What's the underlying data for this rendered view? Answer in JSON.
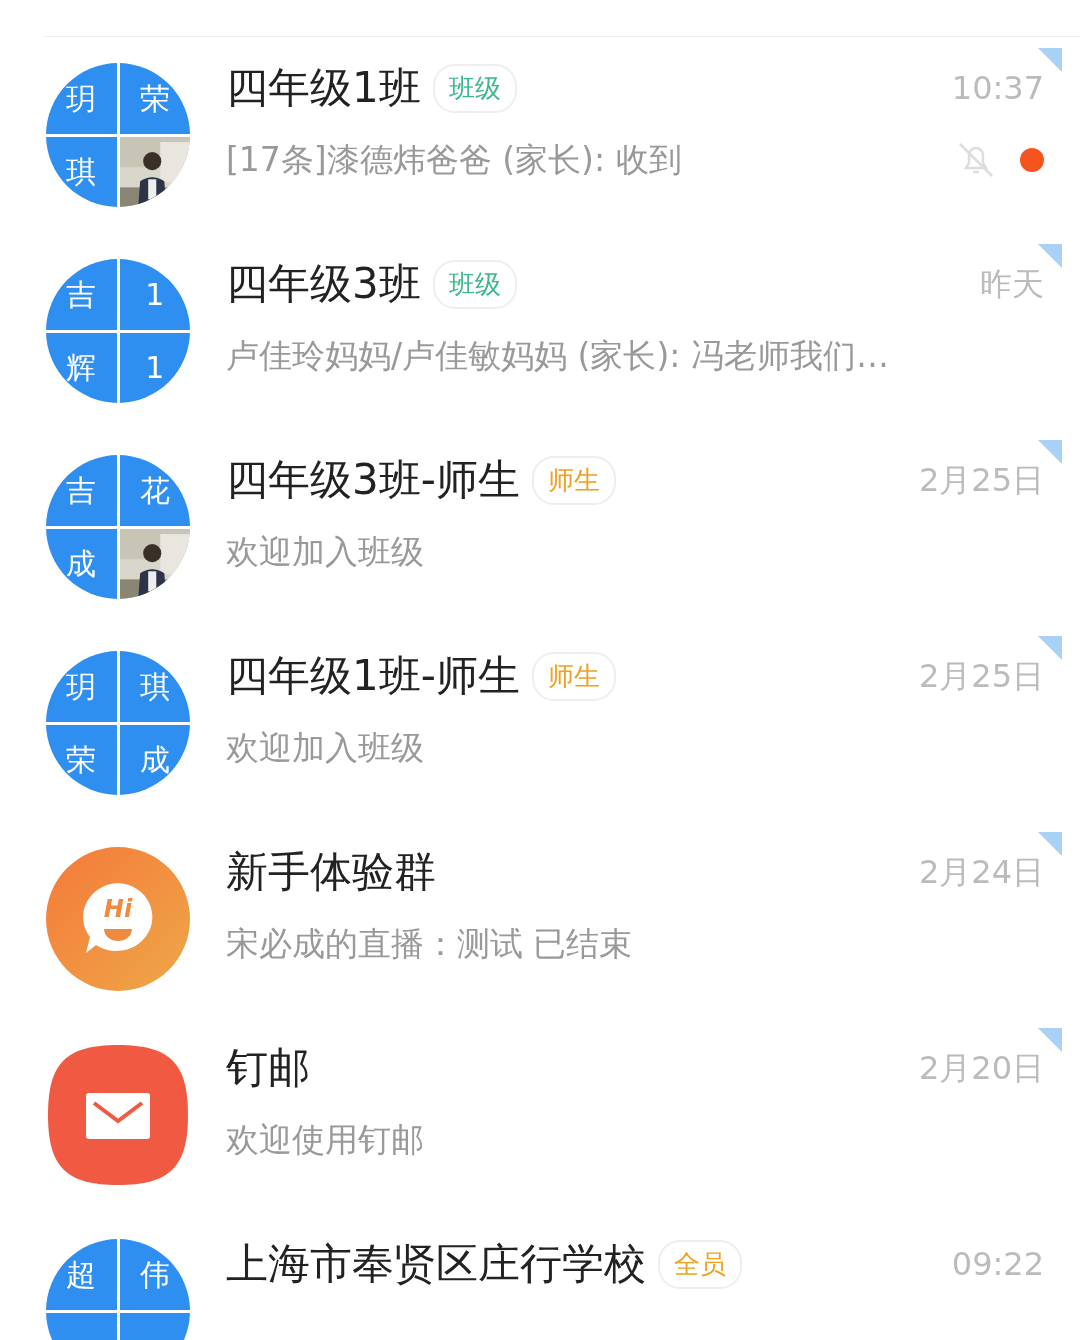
{
  "chats": [
    {
      "avatar": {
        "kind": "grid",
        "cells": [
          {
            "kind": "text",
            "text": "玥"
          },
          {
            "kind": "text",
            "text": "荣"
          },
          {
            "kind": "text",
            "text": "琪"
          },
          {
            "kind": "picture"
          }
        ]
      },
      "title": "四年级1班",
      "tag": {
        "text": "班级",
        "color": "#3cb88a"
      },
      "time": "10:37",
      "preview": "[17条]漆德炜爸爸 (家长): 收到",
      "muted": true,
      "unread": true,
      "pinned": true
    },
    {
      "avatar": {
        "kind": "grid",
        "cells": [
          {
            "kind": "text",
            "text": "吉"
          },
          {
            "kind": "text",
            "text": "1"
          },
          {
            "kind": "text",
            "text": "辉"
          },
          {
            "kind": "text",
            "text": "1"
          }
        ]
      },
      "title": "四年级3班",
      "tag": {
        "text": "班级",
        "color": "#3cb88a"
      },
      "time": "昨天",
      "preview": "卢佳玲妈妈/卢佳敏妈妈 (家长): 冯老师我们…",
      "pinned": true
    },
    {
      "avatar": {
        "kind": "grid",
        "cells": [
          {
            "kind": "text",
            "text": "吉"
          },
          {
            "kind": "text",
            "text": "花"
          },
          {
            "kind": "text",
            "text": "成"
          },
          {
            "kind": "picture"
          }
        ]
      },
      "title": "四年级3班-师生",
      "tag": {
        "text": "师生",
        "color": "#f0a020"
      },
      "time": "2月25日",
      "preview": "欢迎加入班级",
      "pinned": true
    },
    {
      "avatar": {
        "kind": "grid",
        "cells": [
          {
            "kind": "text",
            "text": "玥"
          },
          {
            "kind": "text",
            "text": "琪"
          },
          {
            "kind": "text",
            "text": "荣"
          },
          {
            "kind": "text",
            "text": "成"
          }
        ]
      },
      "title": "四年级1班-师生",
      "tag": {
        "text": "师生",
        "color": "#f0a020"
      },
      "time": "2月25日",
      "preview": "欢迎加入班级",
      "pinned": true
    },
    {
      "avatar": {
        "kind": "hi",
        "logo_text": "Hi"
      },
      "title": "新手体验群",
      "time": "2月24日",
      "preview": "宋必成的直播：测试 已结束",
      "pinned": true
    },
    {
      "avatar": {
        "kind": "mail"
      },
      "title": "钉邮",
      "time": "2月20日",
      "preview": "欢迎使用钉邮",
      "pinned": true
    },
    {
      "avatar": {
        "kind": "grid",
        "cells": [
          {
            "kind": "text",
            "text": "超"
          },
          {
            "kind": "text",
            "text": "伟"
          },
          {
            "kind": "cut"
          },
          {
            "kind": "cut"
          }
        ]
      },
      "title": "上海市奉贤区庄行学校",
      "tag": {
        "text": "全员",
        "color": "#f0a020"
      },
      "time": "09:22"
    }
  ]
}
